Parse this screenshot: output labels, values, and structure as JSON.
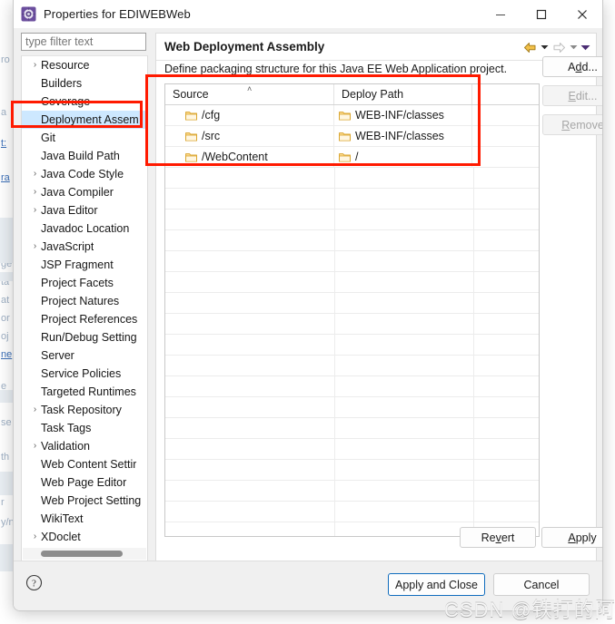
{
  "window": {
    "title": "Properties for EDIWEBWeb",
    "icon": "settings-gear-icon",
    "minimize_label": "—",
    "maximize_label": "□",
    "close_label": "✕"
  },
  "filter": {
    "placeholder": "type filter text",
    "value": ""
  },
  "tree": {
    "items": [
      {
        "label": "Resource",
        "expandable": true,
        "selected": false
      },
      {
        "label": "Builders",
        "expandable": false,
        "selected": false
      },
      {
        "label": "Coverage",
        "expandable": false,
        "selected": false
      },
      {
        "label": "Deployment Assem",
        "expandable": false,
        "selected": true
      },
      {
        "label": "Git",
        "expandable": false,
        "selected": false
      },
      {
        "label": "Java Build Path",
        "expandable": false,
        "selected": false
      },
      {
        "label": "Java Code Style",
        "expandable": true,
        "selected": false
      },
      {
        "label": "Java Compiler",
        "expandable": true,
        "selected": false
      },
      {
        "label": "Java Editor",
        "expandable": true,
        "selected": false
      },
      {
        "label": "Javadoc Location",
        "expandable": false,
        "selected": false
      },
      {
        "label": "JavaScript",
        "expandable": true,
        "selected": false
      },
      {
        "label": "JSP Fragment",
        "expandable": false,
        "selected": false
      },
      {
        "label": "Project Facets",
        "expandable": false,
        "selected": false
      },
      {
        "label": "Project Natures",
        "expandable": false,
        "selected": false
      },
      {
        "label": "Project References",
        "expandable": false,
        "selected": false
      },
      {
        "label": "Run/Debug Setting",
        "expandable": false,
        "selected": false
      },
      {
        "label": "Server",
        "expandable": false,
        "selected": false
      },
      {
        "label": "Service Policies",
        "expandable": false,
        "selected": false
      },
      {
        "label": "Targeted Runtimes",
        "expandable": false,
        "selected": false
      },
      {
        "label": "Task Repository",
        "expandable": true,
        "selected": false
      },
      {
        "label": "Task Tags",
        "expandable": false,
        "selected": false
      },
      {
        "label": "Validation",
        "expandable": true,
        "selected": false
      },
      {
        "label": "Web Content Settir",
        "expandable": false,
        "selected": false
      },
      {
        "label": "Web Page Editor",
        "expandable": false,
        "selected": false
      },
      {
        "label": "Web Project Setting",
        "expandable": false,
        "selected": false
      },
      {
        "label": "WikiText",
        "expandable": false,
        "selected": false
      },
      {
        "label": "XDoclet",
        "expandable": true,
        "selected": false
      }
    ]
  },
  "page": {
    "title": "Web Deployment Assembly",
    "description": "Define packaging structure for this Java EE Web Application project.",
    "nav": {
      "back_icon": "back-arrow-icon",
      "back_caret_icon": "chevron-down-icon",
      "forward_icon": "forward-arrow-icon",
      "forward_caret_icon": "chevron-down-icon",
      "menu_caret_icon": "chevron-down-icon"
    }
  },
  "table": {
    "columns": [
      "Source",
      "Deploy Path",
      ""
    ],
    "sort_indicator": "˄",
    "rows": [
      {
        "source": "/cfg",
        "deploy_path": "WEB-INF/classes"
      },
      {
        "source": "/src",
        "deploy_path": "WEB-INF/classes"
      },
      {
        "source": "/WebContent",
        "deploy_path": "/"
      }
    ],
    "empty_row_count": 19
  },
  "side_buttons": [
    {
      "label_pre": "A",
      "label_key": "d",
      "label_post": "d...",
      "name": "add-button",
      "disabled": false
    },
    {
      "label_pre": "",
      "label_key": "E",
      "label_post": "dit...",
      "name": "edit-button",
      "disabled": true
    },
    {
      "label_pre": "",
      "label_key": "R",
      "label_post": "emove",
      "name": "remove-button",
      "disabled": true
    }
  ],
  "footer_buttons": {
    "revert": {
      "pre": "Re",
      "key": "v",
      "post": "ert"
    },
    "apply": {
      "pre": "",
      "key": "A",
      "post": "pply"
    },
    "apply_and_close": "Apply and Close",
    "cancel": "Cancel",
    "help_icon": "help-question-icon"
  },
  "watermark": "CSDN @铁打的阿秀",
  "colors": {
    "selection": "#cde8ff",
    "annotation": "#ff1a00",
    "focus_border": "#0f6cbd",
    "folder": "#f0b429",
    "title_icon": "#6b4e9e"
  },
  "background_fragments": [
    "ro",
    "a",
    "t:",
    "ra",
    "n",
    "ge",
    "ta",
    "at",
    "or",
    "oj",
    "ne",
    "e",
    "se",
    "th",
    "s",
    "r",
    "y/n"
  ]
}
